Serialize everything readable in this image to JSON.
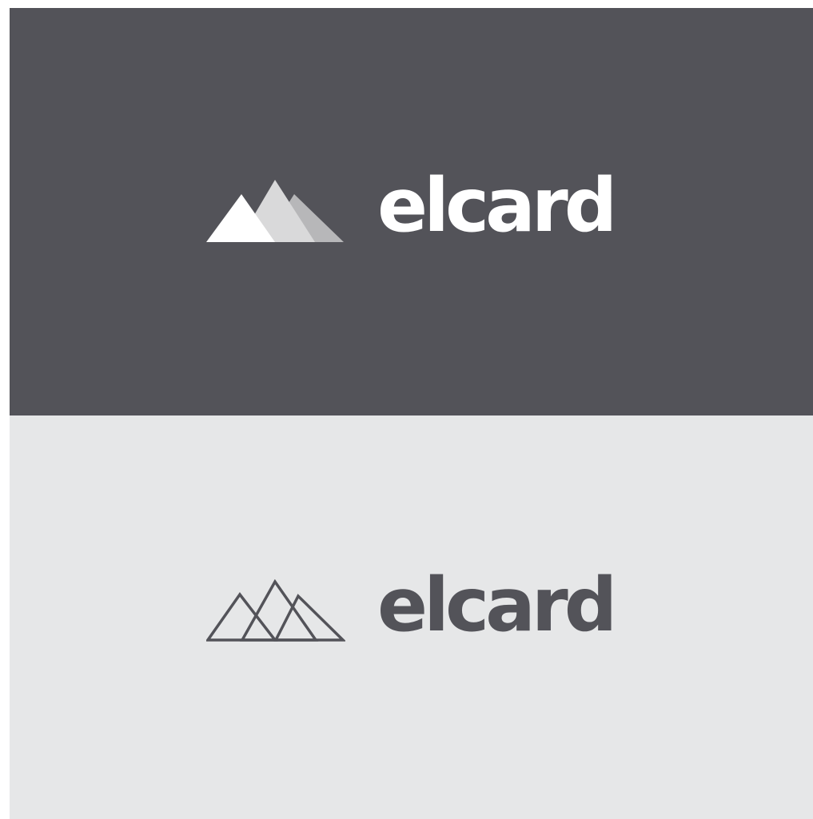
{
  "colors": {
    "dark_background": "#535359",
    "light_background": "#e6e7e8",
    "mark_front": "#ffffff",
    "mark_middle": "#d9d9da",
    "mark_back": "#b7b7b9",
    "outline": "#535359",
    "wordmark_on_dark": "#ffffff",
    "wordmark_on_light": "#535359"
  },
  "logo_dark": {
    "icon": "mountains-filled-icon",
    "wordmark": "elcard"
  },
  "logo_light": {
    "icon": "mountains-outline-icon",
    "wordmark": "elcard"
  }
}
